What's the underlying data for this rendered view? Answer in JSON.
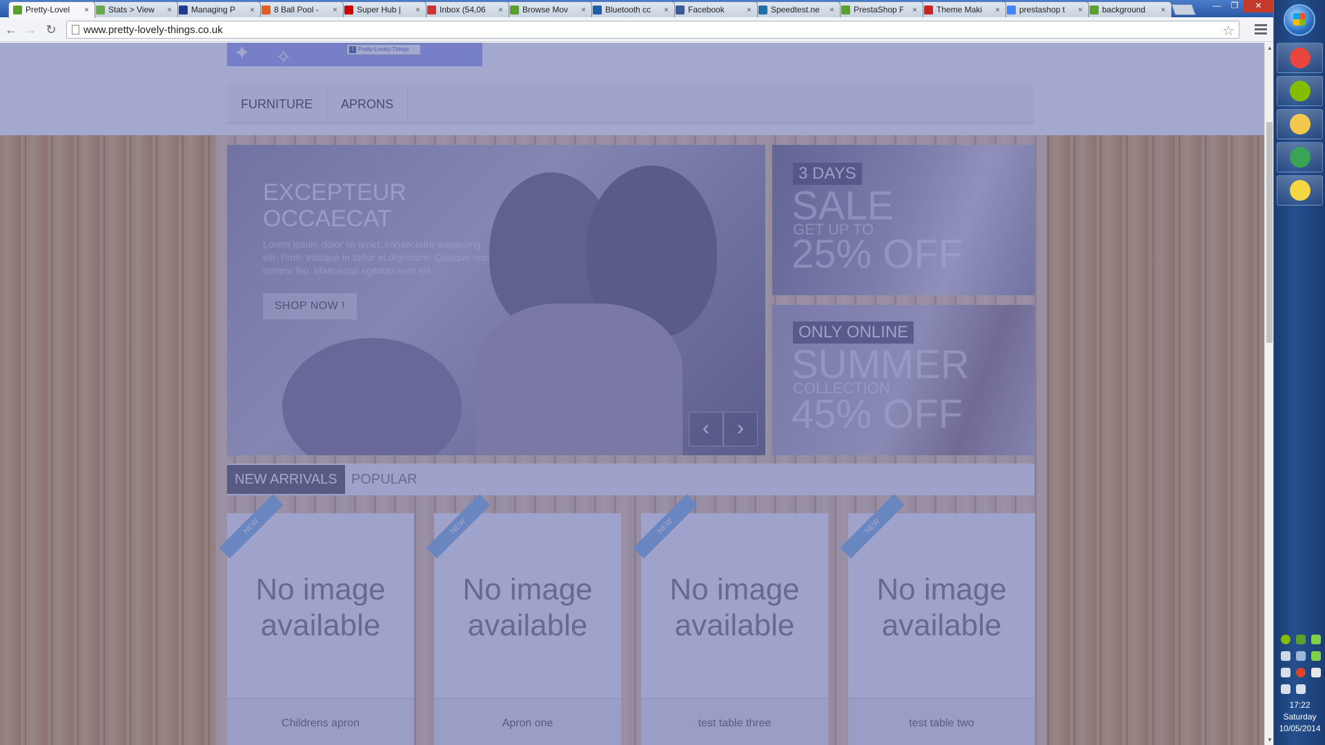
{
  "browser": {
    "tabs": [
      {
        "title": "Pretty-Lovel",
        "color": "#5aa02c"
      },
      {
        "title": "Stats > View",
        "color": "#6aa84f"
      },
      {
        "title": "Managing P",
        "color": "#1f3c8f"
      },
      {
        "title": "8 Ball Pool -",
        "color": "#e35d1f"
      },
      {
        "title": "Super Hub |",
        "color": "#cc0000"
      },
      {
        "title": "Inbox (54,06",
        "color": "#cc3333"
      },
      {
        "title": "Browse Mov",
        "color": "#5aa02c"
      },
      {
        "title": "Bluetooth cc",
        "color": "#1f5fa8"
      },
      {
        "title": "Facebook",
        "color": "#3b5998"
      },
      {
        "title": "Speedtest.ne",
        "color": "#1f6fa8"
      },
      {
        "title": "PrestaShop F",
        "color": "#5aa02c"
      },
      {
        "title": "Theme Maki",
        "color": "#cc2222"
      },
      {
        "title": "prestashop t",
        "color": "#4285f4"
      },
      {
        "title": "background",
        "color": "#5aa02c"
      }
    ],
    "url": "www.pretty-lovely-things.co.uk",
    "close_glyph": "×"
  },
  "site": {
    "fb_badge": "Pretty-Lovely-Things",
    "nav": [
      "FURNITURE",
      "APRONS"
    ],
    "slider": {
      "title": "EXCEPTEUR OCCAECAT",
      "body": "Lorem ipsum dolor sit amet, consectetur adipiscing elit. Proin tristique in tortor et dignissim. Quisque non tempor leo. Maecenas egestas sem elit",
      "button": "SHOP NOW !",
      "prev": "‹",
      "next": "›"
    },
    "promo1": {
      "tag": "3 DAYS",
      "big": "SALE",
      "small": "GET UP TO",
      "big2": "25% OFF"
    },
    "promo2": {
      "tag": "ONLY ONLINE",
      "big": "SUMMER",
      "small": "COLLECTION",
      "big2": "45% OFF"
    },
    "product_tabs": {
      "active": "NEW ARRIVALS",
      "inactive": "POPULAR"
    },
    "products": [
      {
        "name": "Childrens apron",
        "placeholder": "No image available",
        "ribbon": "NEW"
      },
      {
        "name": "Apron one",
        "placeholder": "No image available",
        "ribbon": "NEW"
      },
      {
        "name": "test table three",
        "placeholder": "No image available",
        "ribbon": "NEW"
      },
      {
        "name": "test table two",
        "placeholder": "No image available",
        "ribbon": "NEW"
      }
    ]
  },
  "taskbar": {
    "time": "17:22",
    "day": "Saturday",
    "date": "10/05/2014",
    "apps": [
      {
        "name": "chrome-icon",
        "color": "#e8453c"
      },
      {
        "name": "spotify-icon",
        "color": "#84bd00"
      },
      {
        "name": "file-explorer-icon",
        "color": "#f2c94c"
      },
      {
        "name": "task-manager-icon",
        "color": "#3aa356"
      },
      {
        "name": "sticky-notes-icon",
        "color": "#f5d742"
      }
    ]
  }
}
